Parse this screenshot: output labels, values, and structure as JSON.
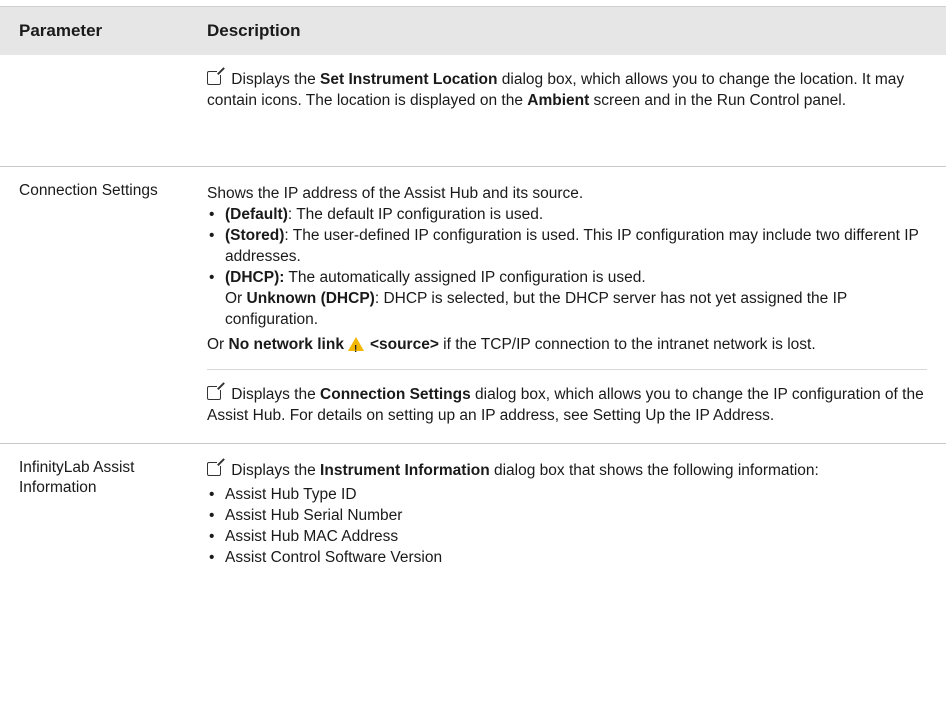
{
  "header": {
    "parameter": "Parameter",
    "description": "Description"
  },
  "row1": {
    "sub1": {
      "pre": " Displays the ",
      "b1": "Set Instrument Location",
      "mid": " dialog box, which allows you to change the location. It may contain icons. The location is displayed on the ",
      "b2": "Ambient",
      "post": " screen and in the Run Control panel."
    }
  },
  "row2": {
    "param": "Connection Settings",
    "intro": "Shows the IP address of the Assist Hub and its source.",
    "items": [
      {
        "b": "(Default)",
        "t": ": The default IP configuration is used."
      },
      {
        "b": "(Stored)",
        "t": ": The user-defined IP configuration is used. This IP configuration may include two different IP addresses."
      },
      {
        "b": "(DHCP):",
        "t": " The automatically assigned IP configuration is used.",
        "or": "Or ",
        "b2": "Unknown (DHCP)",
        "t2": ": DHCP is selected, but the DHCP server has not yet assigned the IP configuration."
      }
    ],
    "or_pre": "Or ",
    "or_b": "No network link",
    "or_b2": "<source>",
    "or_post": " if the TCP/IP connection to the intranet network is lost.",
    "sub2": {
      "pre": " Displays the ",
      "b1": "Connection Settings",
      "post": " dialog box, which allows you to change the IP configuration of the Assist Hub. For details on setting up an IP address, see Setting Up the IP Address."
    }
  },
  "row3": {
    "param": "InfinityLab Assist Information",
    "pre": " Displays the ",
    "b1": "Instrument Information",
    "post": " dialog box that shows the following information:",
    "items": [
      "Assist Hub Type ID",
      "Assist Hub Serial Number",
      "Assist Hub MAC Address",
      "Assist Control Software Version"
    ]
  }
}
